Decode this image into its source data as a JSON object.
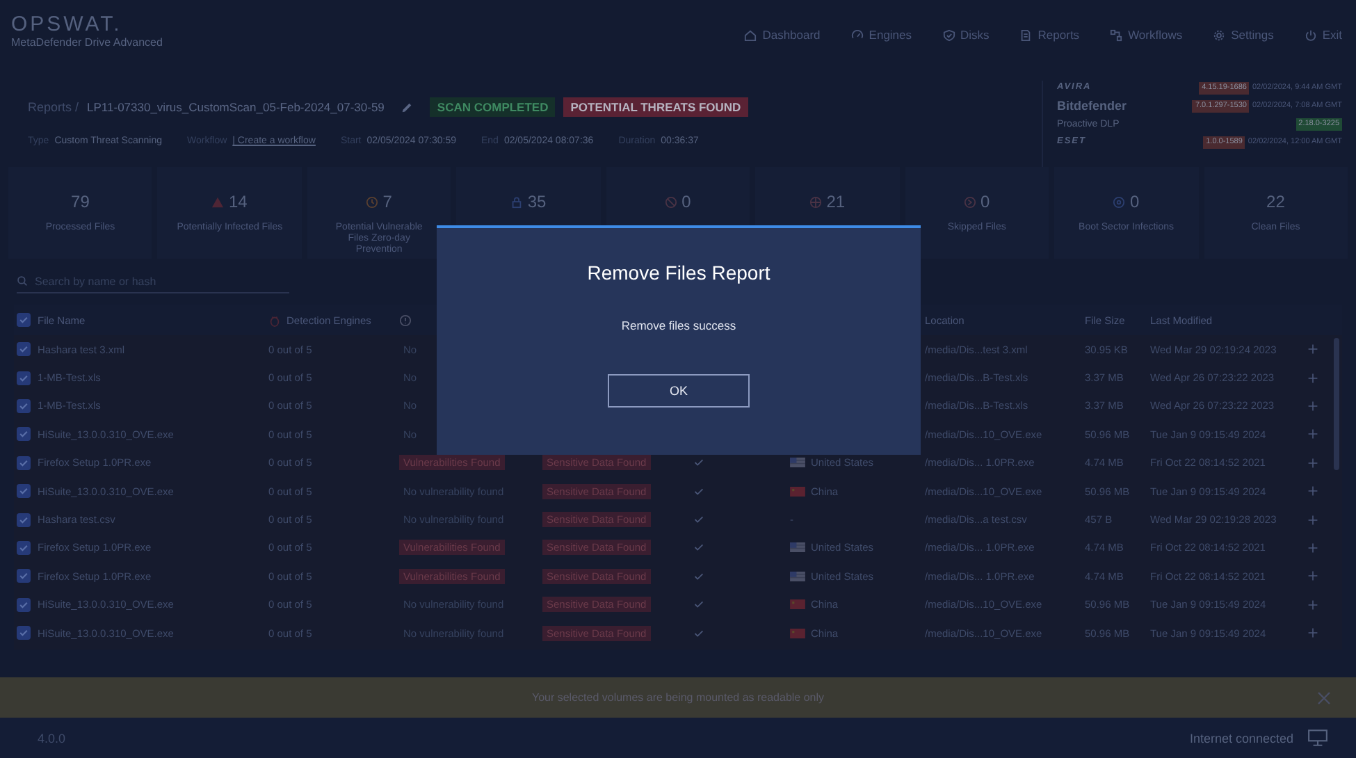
{
  "brand": {
    "logo": "OPSWAT.",
    "product": "MetaDefender Drive Advanced"
  },
  "nav": [
    {
      "label": "Dashboard"
    },
    {
      "label": "Engines"
    },
    {
      "label": "Disks"
    },
    {
      "label": "Reports"
    },
    {
      "label": "Workflows"
    },
    {
      "label": "Settings"
    },
    {
      "label": "Exit"
    }
  ],
  "report": {
    "crumb": "Reports /",
    "name": "LP11-07330_virus_CustomScan_05-Feb-2024_07-30-59",
    "badges": [
      {
        "text": "SCAN COMPLETED",
        "kind": "ok"
      },
      {
        "text": "POTENTIAL THREATS FOUND",
        "kind": "alert"
      }
    ],
    "meta": [
      {
        "label": "Type",
        "value": "Custom Threat Scanning",
        "kind": "text"
      },
      {
        "label": "Workflow",
        "value": "| Create a workflow",
        "kind": "link"
      },
      {
        "label": "Start",
        "value": "02/05/2024 07:30:59",
        "kind": "text"
      },
      {
        "label": "End",
        "value": "02/05/2024 08:07:36",
        "kind": "text"
      },
      {
        "label": "Duration",
        "value": "00:36:37",
        "kind": "text"
      }
    ]
  },
  "engines": [
    {
      "name": "AVIRA",
      "kind": "logo",
      "badge": {
        "text": "4.15.19-1686",
        "color": "#4a2a30"
      },
      "date": "02/02/2024, 9:44 AM GMT"
    },
    {
      "name": "Bitdefender",
      "kind": "title",
      "badge": {
        "text": "7.0.1.297-1530",
        "color": "#4a2a30"
      },
      "date": "02/02/2024, 7:08 AM GMT"
    },
    {
      "name": "Proactive DLP",
      "kind": "plain",
      "badge": {
        "text": "2.18.0-3225",
        "color": "#1f4a35"
      }
    },
    {
      "name": "ESET",
      "kind": "logo",
      "badge": {
        "text": "1.0.0-1589",
        "color": "#4a2a30"
      },
      "date": "02/02/2024, 12:00 AM GMT"
    }
  ],
  "stats": [
    {
      "value": "79",
      "label": "Processed Files"
    },
    {
      "value": "14",
      "label": "Potentially Infected Files"
    },
    {
      "value": "7",
      "label": "Potential Vulnerable Files Zero-day Prevention"
    },
    {
      "value": "35"
    },
    {
      "value": "0"
    },
    {
      "value": "21"
    },
    {
      "value": "0",
      "label": "Skipped Files"
    },
    {
      "value": "0",
      "label": "Boot Sector Infections"
    },
    {
      "value": "22",
      "label": "Clean Files"
    }
  ],
  "search": {
    "placeholder": "Search by name or hash"
  },
  "table": {
    "header_checked": true,
    "columns": [
      {
        "label": "File Name"
      },
      {
        "label": "Detection Engines"
      },
      {},
      {},
      {},
      {},
      {
        "label": "Location"
      },
      {
        "label": "File Size"
      },
      {
        "label": "Last Modified"
      }
    ],
    "rows": [
      {
        "checked": true,
        "name": "Hashara test 3.xml",
        "engines": "0 out of 5",
        "vuln": {
          "text": "No",
          "kind": "plain"
        },
        "location": "/media/Dis...test 3.xml",
        "size": "30.95 KB",
        "modified": "Wed Mar 29 02:19:24 2023"
      },
      {
        "checked": true,
        "name": "1-MB-Test.xls",
        "engines": "0 out of 5",
        "vuln": {
          "text": "No",
          "kind": "plain"
        },
        "location": "/media/Dis...B-Test.xls",
        "size": "3.37 MB",
        "modified": "Wed Apr 26 07:23:22 2023"
      },
      {
        "checked": true,
        "name": "1-MB-Test.xls",
        "engines": "0 out of 5",
        "vuln": {
          "text": "No",
          "kind": "plain"
        },
        "location": "/media/Dis...B-Test.xls",
        "size": "3.37 MB",
        "modified": "Wed Apr 26 07:23:22 2023"
      },
      {
        "checked": true,
        "name": "HiSuite_13.0.0.310_OVE.exe",
        "engines": "0 out of 5",
        "vuln": {
          "text": "No",
          "kind": "plain"
        },
        "location": "/media/Dis...10_OVE.exe",
        "size": "50.96 MB",
        "modified": "Tue Jan 9 09:15:49 2024"
      },
      {
        "checked": true,
        "name": "Firefox Setup 1.0PR.exe",
        "engines": "0 out of 5",
        "vuln": {
          "text": "Vulnerabilities Found",
          "kind": "alert"
        },
        "sensitive": "Sensitive Data Found",
        "verified": true,
        "country": {
          "text": "United States",
          "kind": "us"
        },
        "location": "/media/Dis... 1.0PR.exe",
        "size": "4.74 MB",
        "modified": "Fri Oct 22 08:14:52 2021"
      },
      {
        "checked": true,
        "name": "HiSuite_13.0.0.310_OVE.exe",
        "engines": "0 out of 5",
        "vuln": {
          "text": "No vulnerability found",
          "kind": "plain"
        },
        "sensitive": "Sensitive Data Found",
        "verified": true,
        "country": {
          "text": "China",
          "kind": "cn"
        },
        "location": "/media/Dis...10_OVE.exe",
        "size": "50.96 MB",
        "modified": "Tue Jan 9 09:15:49 2024"
      },
      {
        "checked": true,
        "name": "Hashara test.csv",
        "engines": "0 out of 5",
        "vuln": {
          "text": "No vulnerability found",
          "kind": "plain"
        },
        "sensitive": "Sensitive Data Found",
        "verified": true,
        "country": {
          "text": "-",
          "kind": "none"
        },
        "location": "/media/Dis...a test.csv",
        "size": "457 B",
        "modified": "Wed Mar 29 02:19:28 2023"
      },
      {
        "checked": true,
        "name": "Firefox Setup 1.0PR.exe",
        "engines": "0 out of 5",
        "vuln": {
          "text": "Vulnerabilities Found",
          "kind": "alert"
        },
        "sensitive": "Sensitive Data Found",
        "verified": true,
        "country": {
          "text": "United States",
          "kind": "us"
        },
        "location": "/media/Dis... 1.0PR.exe",
        "size": "4.74 MB",
        "modified": "Fri Oct 22 08:14:52 2021"
      },
      {
        "checked": true,
        "name": "Firefox Setup 1.0PR.exe",
        "engines": "0 out of 5",
        "vuln": {
          "text": "Vulnerabilities Found",
          "kind": "alert"
        },
        "sensitive": "Sensitive Data Found",
        "verified": true,
        "country": {
          "text": "United States",
          "kind": "us"
        },
        "location": "/media/Dis... 1.0PR.exe",
        "size": "4.74 MB",
        "modified": "Fri Oct 22 08:14:52 2021"
      },
      {
        "checked": true,
        "name": "HiSuite_13.0.0.310_OVE.exe",
        "engines": "0 out of 5",
        "vuln": {
          "text": "No vulnerability found",
          "kind": "plain"
        },
        "sensitive": "Sensitive Data Found",
        "verified": true,
        "country": {
          "text": "China",
          "kind": "cn"
        },
        "location": "/media/Dis...10_OVE.exe",
        "size": "50.96 MB",
        "modified": "Tue Jan 9 09:15:49 2024"
      },
      {
        "checked": true,
        "name": "HiSuite_13.0.0.310_OVE.exe",
        "engines": "0 out of 5",
        "vuln": {
          "text": "No vulnerability found",
          "kind": "plain"
        },
        "sensitive": "Sensitive Data Found",
        "verified": true,
        "country": {
          "text": "China",
          "kind": "cn"
        },
        "location": "/media/Dis...10_OVE.exe",
        "size": "50.96 MB",
        "modified": "Tue Jan 9 09:15:49 2024"
      }
    ]
  },
  "banner": {
    "text": "Your selected volumes are being mounted as readable only"
  },
  "footer": {
    "version": "4.0.0",
    "status": "Internet connected"
  },
  "modal": {
    "title": "Remove Files Report",
    "message": "Remove files success",
    "button": "OK"
  }
}
